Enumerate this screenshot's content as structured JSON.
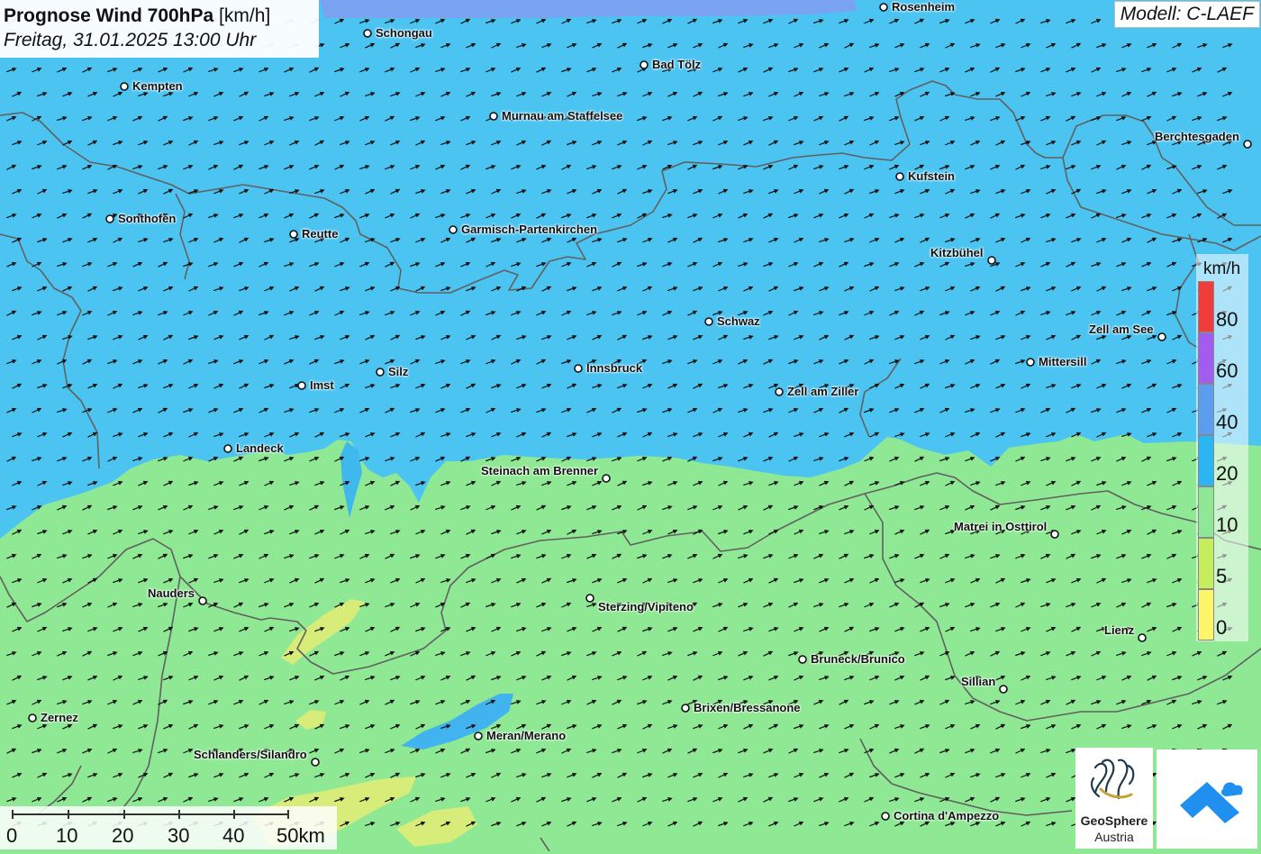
{
  "header": {
    "title_bold": "Prognose Wind 700hPa",
    "title_unit": "[km/h]",
    "date": "Freitag, 31.01.2025 13:00 Uhr",
    "model": "Modell: C-LAEF"
  },
  "cities": [
    {
      "name": "Rosenheim"
    },
    {
      "name": "Schongau"
    },
    {
      "name": "Bad Tölz"
    },
    {
      "name": "Kempten"
    },
    {
      "name": "Murnau am Staffelsee"
    },
    {
      "name": "Berchtesgaden"
    },
    {
      "name": "Kufstein"
    },
    {
      "name": "Sonthofen"
    },
    {
      "name": "Reutte"
    },
    {
      "name": "Garmisch-Partenkirchen"
    },
    {
      "name": "Kitzbühel"
    },
    {
      "name": "Schwaz"
    },
    {
      "name": "Zell am See"
    },
    {
      "name": "Mittersill"
    },
    {
      "name": "Innsbruck"
    },
    {
      "name": "Silz"
    },
    {
      "name": "Imst"
    },
    {
      "name": "Zell am Ziller"
    },
    {
      "name": "Landeck"
    },
    {
      "name": "Steinach am Brenner"
    },
    {
      "name": "Matrei in Osttirol"
    },
    {
      "name": "Nauders"
    },
    {
      "name": "Sterzing/Vipiteno"
    },
    {
      "name": "Lienz"
    },
    {
      "name": "Bruneck/Brunico"
    },
    {
      "name": "Sillian"
    },
    {
      "name": "Brixen/Bressanone"
    },
    {
      "name": "Zernez"
    },
    {
      "name": "Meran/Merano"
    },
    {
      "name": "Schlanders/Silandro"
    },
    {
      "name": "Cortina d'Ampezzo"
    }
  ],
  "legend": {
    "unit": "km/h",
    "classes": [
      {
        "label": "80",
        "color": "#f23b3b"
      },
      {
        "label": "60",
        "color": "#a35cf0"
      },
      {
        "label": "40",
        "color": "#5b9ef0"
      },
      {
        "label": "20",
        "color": "#29b6f2"
      },
      {
        "label": "10",
        "color": "#8ee896"
      },
      {
        "label": "5",
        "color": "#c5ee5c"
      },
      {
        "label": "0",
        "color": "#fdf66a"
      }
    ]
  },
  "scale_bar": {
    "labels": [
      "0",
      "10",
      "20",
      "30",
      "40",
      "50km"
    ]
  },
  "logos": {
    "geosphere_name": "GeoSphere",
    "geosphere_sub": "Austria"
  },
  "colors": {
    "wind_10_20": "#4cc4f2",
    "wind_5_10": "#8fe894",
    "wind_0_5": "#ecec6c",
    "border": "#606060",
    "arrow": "#111111"
  }
}
